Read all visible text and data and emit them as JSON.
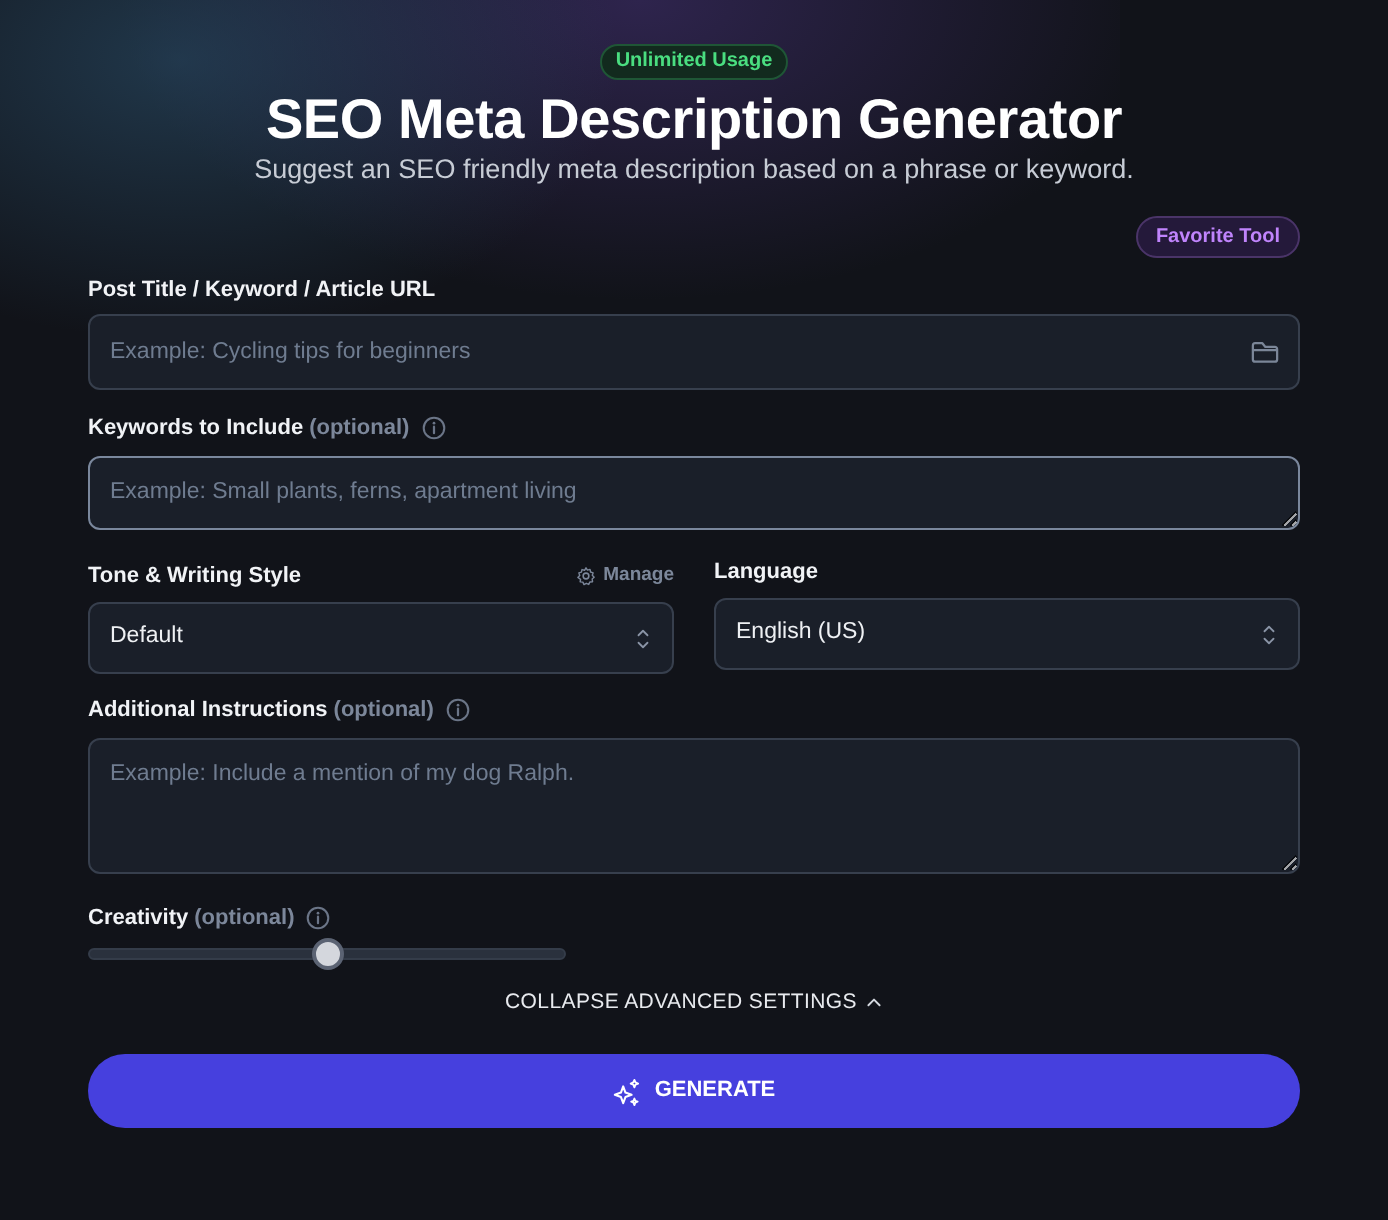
{
  "header": {
    "badge": "Unlimited Usage",
    "title": "SEO Meta Description Generator",
    "subtitle": "Suggest an SEO friendly meta description based on a phrase or keyword.",
    "favorite_button": "Favorite Tool"
  },
  "post_title": {
    "label": "Post Title / Keyword / Article URL",
    "placeholder": "Example: Cycling tips for beginners",
    "focused": false
  },
  "keywords": {
    "label": "Keywords to Include",
    "optional_note": "(optional)",
    "info_icon": true,
    "placeholder": "Example: Small plants, ferns, apartment living",
    "focused": true
  },
  "tone": {
    "label": "Tone & Writing Style",
    "manage_link": "Manage",
    "value": "Default"
  },
  "language": {
    "label": "Language",
    "value": "English (US)"
  },
  "instructions": {
    "label": "Additional Instructions",
    "optional_note": "(optional)",
    "info_icon": true,
    "placeholder": "Example: Include a mention of my dog Ralph.",
    "focused": false
  },
  "creativity": {
    "label": "Creativity",
    "optional_note": "(optional)",
    "info_icon": true,
    "level": 0.5
  },
  "collapse_link": "COLLAPSE ADVANCED SETTINGS",
  "generate_button": "GENERATE"
}
